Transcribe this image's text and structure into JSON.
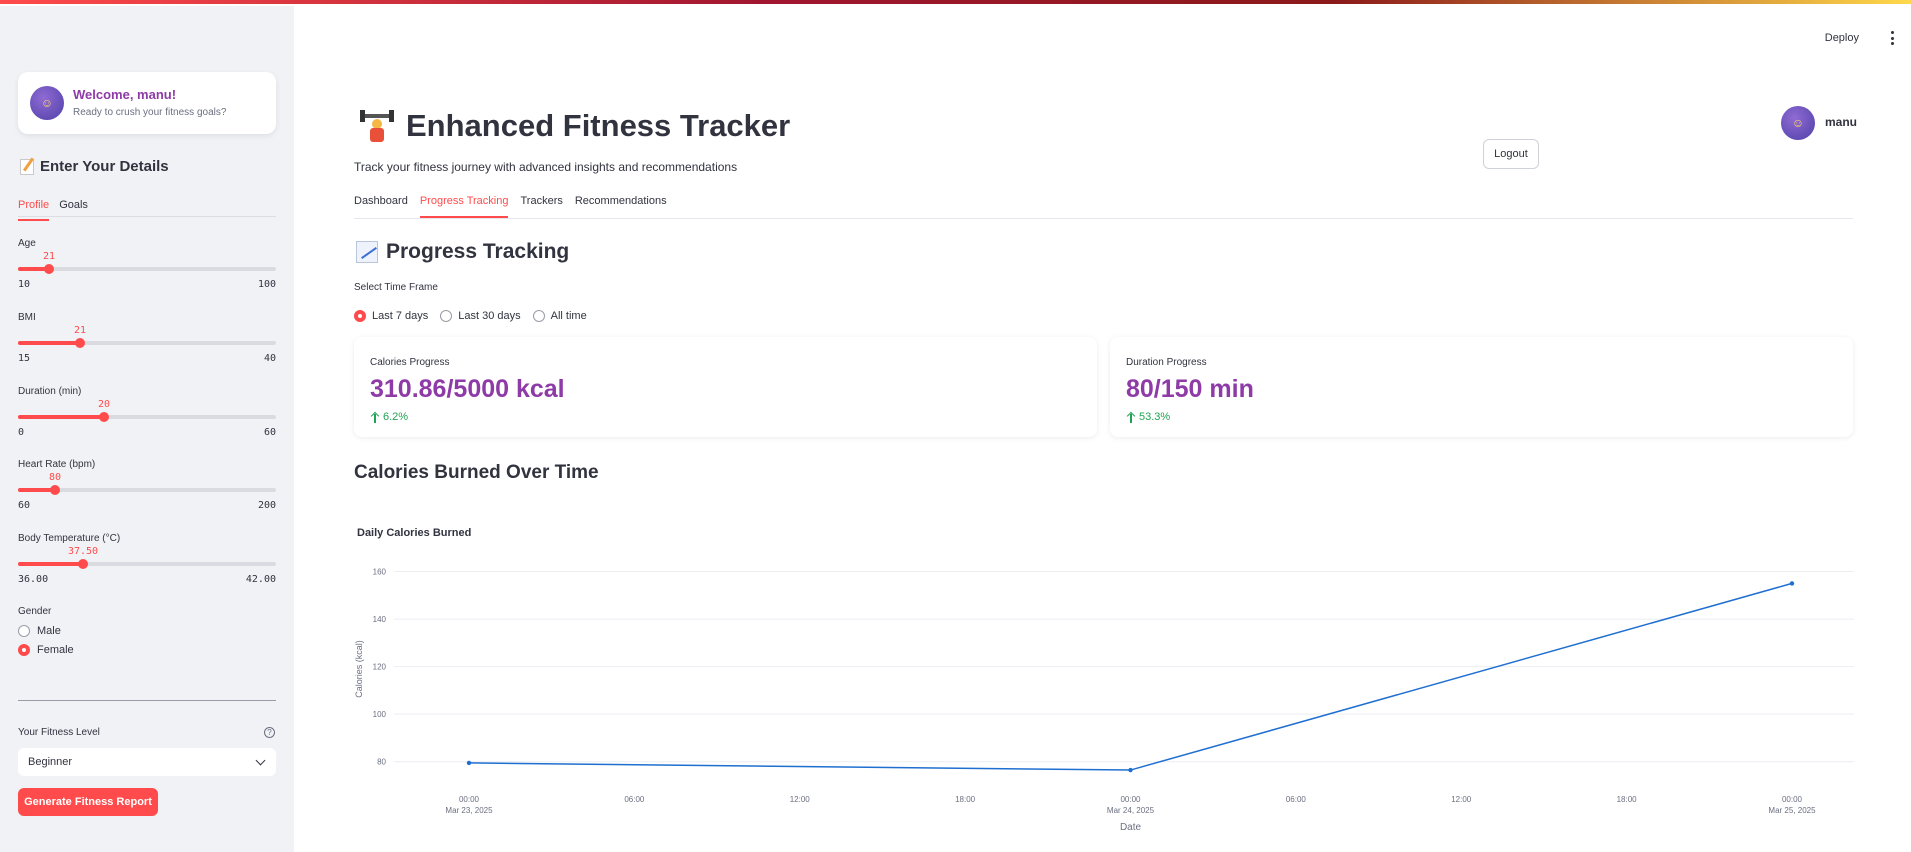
{
  "app": {
    "deploy_label": "Deploy",
    "menu_icon": "kebab-menu-icon"
  },
  "sidebar": {
    "welcome_title": "Welcome, manu!",
    "welcome_subtitle": "Ready to crush your fitness goals?",
    "avatar_icon": "avatar-emoji",
    "section_title": "Enter Your Details",
    "section_icon": "memo-icon",
    "tabs": [
      {
        "label": "Profile",
        "active": true
      },
      {
        "label": "Goals",
        "active": false
      }
    ],
    "sliders": [
      {
        "label": "Age",
        "value": "21",
        "min": "10",
        "max": "100",
        "fraction": 0.122
      },
      {
        "label": "BMI",
        "value": "21",
        "min": "15",
        "max": "40",
        "fraction": 0.24
      },
      {
        "label": "Duration (min)",
        "value": "20",
        "min": "0",
        "max": "60",
        "fraction": 0.333
      },
      {
        "label": "Heart Rate (bpm)",
        "value": "80",
        "min": "60",
        "max": "200",
        "fraction": 0.143
      },
      {
        "label": "Body Temperature (°C)",
        "value": "37.50",
        "min": "36.00",
        "max": "42.00",
        "fraction": 0.25
      }
    ],
    "gender_label": "Gender",
    "gender_options": [
      {
        "label": "Male",
        "selected": false
      },
      {
        "label": "Female",
        "selected": true
      }
    ],
    "fitness_level_label": "Your Fitness Level",
    "fitness_level_value": "Beginner",
    "help_icon": "question-circle-icon",
    "generate_button": "Generate Fitness Report"
  },
  "main": {
    "title": "Enhanced Fitness Tracker",
    "title_icon": "weightlifter-icon",
    "subtitle": "Track your fitness journey with advanced insights and recommendations",
    "user_name": "manu",
    "logout_label": "Logout",
    "tabs": [
      {
        "label": "Dashboard",
        "active": false
      },
      {
        "label": "Progress Tracking",
        "active": true
      },
      {
        "label": "Trackers",
        "active": false
      },
      {
        "label": "Recommendations",
        "active": false
      }
    ],
    "progress_heading": "Progress Tracking",
    "progress_icon": "chart-increasing-icon",
    "timeframe_label": "Select Time Frame",
    "timeframe_options": [
      {
        "label": "Last 7 days",
        "selected": true
      },
      {
        "label": "Last 30 days",
        "selected": false
      },
      {
        "label": "All time",
        "selected": false
      }
    ],
    "metrics": [
      {
        "label": "Calories Progress",
        "value": "310.86/5000 kcal",
        "delta": "6.2%"
      },
      {
        "label": "Duration Progress",
        "value": "80/150 min",
        "delta": "53.3%"
      }
    ],
    "chart_section_title": "Calories Burned Over Time",
    "accent_color": "#ff4b4b",
    "metric_color": "#8e3aa7",
    "delta_color": "#21a354",
    "line_color": "#1f6fd1"
  },
  "chart_data": {
    "type": "line",
    "title": "Daily Calories Burned",
    "xlabel": "Date",
    "ylabel": "Calories (kcal)",
    "ylim": [
      74,
      164
    ],
    "yticks": [
      80,
      100,
      120,
      140,
      160
    ],
    "xticks": [
      {
        "time": "00:00",
        "date": "Mar 23, 2025"
      },
      {
        "time": "06:00",
        "date": ""
      },
      {
        "time": "12:00",
        "date": ""
      },
      {
        "time": "18:00",
        "date": ""
      },
      {
        "time": "00:00",
        "date": "Mar 24, 2025"
      },
      {
        "time": "06:00",
        "date": ""
      },
      {
        "time": "12:00",
        "date": ""
      },
      {
        "time": "18:00",
        "date": ""
      },
      {
        "time": "00:00",
        "date": "Mar 25, 2025"
      }
    ],
    "x": [
      "2025-03-23 00:00",
      "2025-03-24 00:00",
      "2025-03-25 00:00"
    ],
    "values": [
      79.5,
      76.5,
      155
    ],
    "grid": true,
    "legend": "none"
  }
}
